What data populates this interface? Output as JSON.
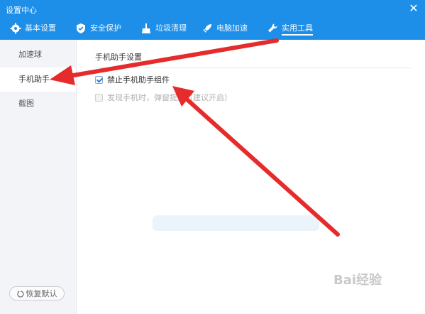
{
  "window": {
    "title": "设置中心",
    "close_icon": "close-icon"
  },
  "tabs": [
    {
      "label": "基本设置",
      "icon": "gear-icon",
      "active": false
    },
    {
      "label": "安全保护",
      "icon": "shield-icon",
      "active": false
    },
    {
      "label": "垃圾清理",
      "icon": "broom-icon",
      "active": false
    },
    {
      "label": "电脑加速",
      "icon": "rocket-icon",
      "active": false
    },
    {
      "label": "实用工具",
      "icon": "wrench-icon",
      "active": true
    }
  ],
  "sidebar": {
    "items": [
      {
        "label": "加速球",
        "active": false
      },
      {
        "label": "手机助手",
        "active": true
      },
      {
        "label": "截图",
        "active": false
      }
    ],
    "restore_button": "恢复默认"
  },
  "content": {
    "section_title": "手机助手设置",
    "options": [
      {
        "label": "禁止手机助手组件",
        "checked": true,
        "disabled": false
      },
      {
        "label": "发现手机时，弹窗提醒（建议开启）",
        "checked": false,
        "disabled": true
      }
    ]
  },
  "overlay": {
    "watermark": "Bai经验",
    "annotation_color": "#e52b2b"
  },
  "colors": {
    "accent": "#1e8fe8",
    "sidebar_bg": "#f2f4f7",
    "arrow": "#e52b2b"
  }
}
